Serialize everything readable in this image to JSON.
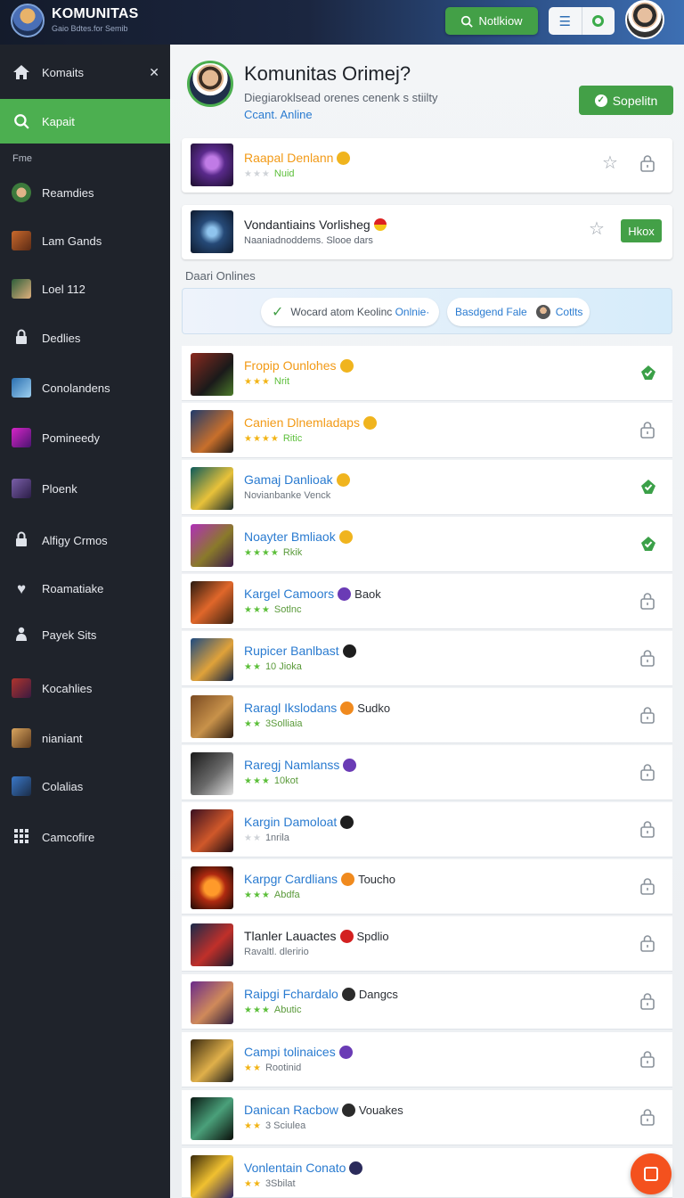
{
  "app": {
    "title": "KOMUNITAS",
    "subtitle": "Gaio Bdtes.for Semib",
    "notif_label": "Notlkiow",
    "menu_icon": "hamburger-icon",
    "status_icon": "online-ring-icon"
  },
  "sidebar": {
    "section_label": "Fme",
    "items": [
      {
        "label": "Komaits",
        "icon": "home-icon"
      },
      {
        "label": "Kapait",
        "icon": "search-icon"
      },
      {
        "label": "Reamdies",
        "icon": "game-thumb-icon"
      },
      {
        "label": "Lam Gands",
        "icon": "game-thumb-icon"
      },
      {
        "label": "Loel 112",
        "icon": "game-thumb-icon"
      },
      {
        "label": "Dedlies",
        "icon": "lock-icon"
      },
      {
        "label": "Conolandens",
        "icon": "game-thumb-icon"
      },
      {
        "label": "Pomineedy",
        "icon": "game-thumb-icon"
      },
      {
        "label": "Ploenk",
        "icon": "game-thumb-icon"
      },
      {
        "label": "Alfigy Crmos",
        "icon": "lock-icon"
      },
      {
        "label": "Roamatiake",
        "icon": "heart-icon"
      },
      {
        "label": "Payek Sits",
        "icon": "user-icon"
      },
      {
        "label": "Kocahlies",
        "icon": "game-thumb-icon"
      },
      {
        "label": "nianiant",
        "icon": "game-thumb-icon"
      },
      {
        "label": "Colalias",
        "icon": "game-thumb-icon"
      },
      {
        "label": "Camcofire",
        "icon": "grid-icon"
      }
    ]
  },
  "hero": {
    "title": "Komunitas Orimej?",
    "description": "Diegiaroklsead orenes cenenk s stiilty",
    "link": "Ccant. Anline",
    "button_label": "Sopelitn"
  },
  "featured": [
    {
      "name": "Raapal Denlann",
      "sub": "Nuid",
      "stars": 3
    },
    {
      "name": "Vondantiains Vorlisheg",
      "sub": "Naaniadnoddems. Slooe dars",
      "button": "Hkox"
    }
  ],
  "section_label": "Daari Onlines",
  "filters": [
    {
      "text": "Wocard atom Keolinc",
      "highlight": "Onlnie·"
    },
    {
      "text": "Basdgend Fale",
      "highlight": "Cotlts"
    }
  ],
  "games": [
    {
      "name": "Fropip Ounlohes",
      "sub": "Nrit",
      "stars": "★★★",
      "star_color": "gold",
      "style": "orange",
      "coin": "#f0b41e",
      "action": "green"
    },
    {
      "name": "Canien Dlnemladaps",
      "sub": "Ritic",
      "stars": "★★★★",
      "star_color": "gold",
      "style": "orange",
      "coin": "#f0b41e",
      "action": "grey"
    },
    {
      "name": "Gamaj Danlioak",
      "sub": "Novianbanke Venck",
      "stars": "",
      "star_color": "gold",
      "style": "blue",
      "coin": "#f0b41e",
      "action": "green"
    },
    {
      "name": "Noayter Bmliaok",
      "sub": "Rkik",
      "stars": "★★★★",
      "star_color": "green",
      "style": "blue",
      "coin": "#f0b41e",
      "action": "green"
    },
    {
      "name": "Kargel Camoors",
      "extra": "Baok",
      "sub": "Sotlnc",
      "stars": "★★★",
      "star_color": "green",
      "style": "blue",
      "coin": "#6a3bb5",
      "action": "grey"
    },
    {
      "name": "Rupicer Banlbast",
      "sub": "10 Jioka",
      "stars": "★★",
      "star_color": "green",
      "style": "blue",
      "coin": "#1e1e1e",
      "action": "grey"
    },
    {
      "name": "Raragl Ikslodans",
      "extra": "Sudko",
      "sub": "3Solliaia",
      "stars": "★★",
      "star_color": "green",
      "style": "blue",
      "coin": "#f08a1e",
      "action": "grey"
    },
    {
      "name": "Raregj Namlanss",
      "sub": "10kot",
      "stars": "★★★",
      "star_color": "green",
      "style": "blue",
      "coin": "#6a3bb5",
      "action": "grey"
    },
    {
      "name": "Kargin Damoloat",
      "sub": "1nrila",
      "stars": "★★",
      "star_color": "grey",
      "style": "blue",
      "coin": "#1e1e1e",
      "action": "grey"
    },
    {
      "name": "Karpgr Cardlians",
      "extra": "Toucho",
      "sub": "Abdfa",
      "stars": "★★★",
      "star_color": "green",
      "style": "blue",
      "coin": "#f08a1e",
      "action": "grey"
    },
    {
      "name": "Tlanler Lauactes",
      "extra": "Spdlio",
      "sub": "Ravaltl. dleririo",
      "stars": "",
      "star_color": "gold",
      "style": "dark",
      "coin": "#d32020",
      "action": "grey"
    },
    {
      "name": "Raipgi Fchardalo",
      "extra": "Dangcs",
      "sub": "Abutic",
      "stars": "★★★",
      "star_color": "green",
      "style": "blue",
      "coin": "#2b2b2b",
      "action": "grey"
    },
    {
      "name": "Campi tolinaices",
      "sub": "Rootinid",
      "stars": "★★",
      "star_color": "gold",
      "style": "blue",
      "coin": "#6a3bb5",
      "action": "grey"
    },
    {
      "name": "Danican Racbow",
      "extra": "Vouakes",
      "sub": "3 Sciulea",
      "stars": "★★",
      "star_color": "gold",
      "style": "blue",
      "coin": "#2b2b2b",
      "action": "grey"
    },
    {
      "name": "Vonlentain Conato",
      "sub": "3Sbilat",
      "stars": "★★",
      "star_color": "gold",
      "style": "blue",
      "coin": "#2b2b5b",
      "action": "none"
    }
  ],
  "fab_icon": "chat-icon"
}
